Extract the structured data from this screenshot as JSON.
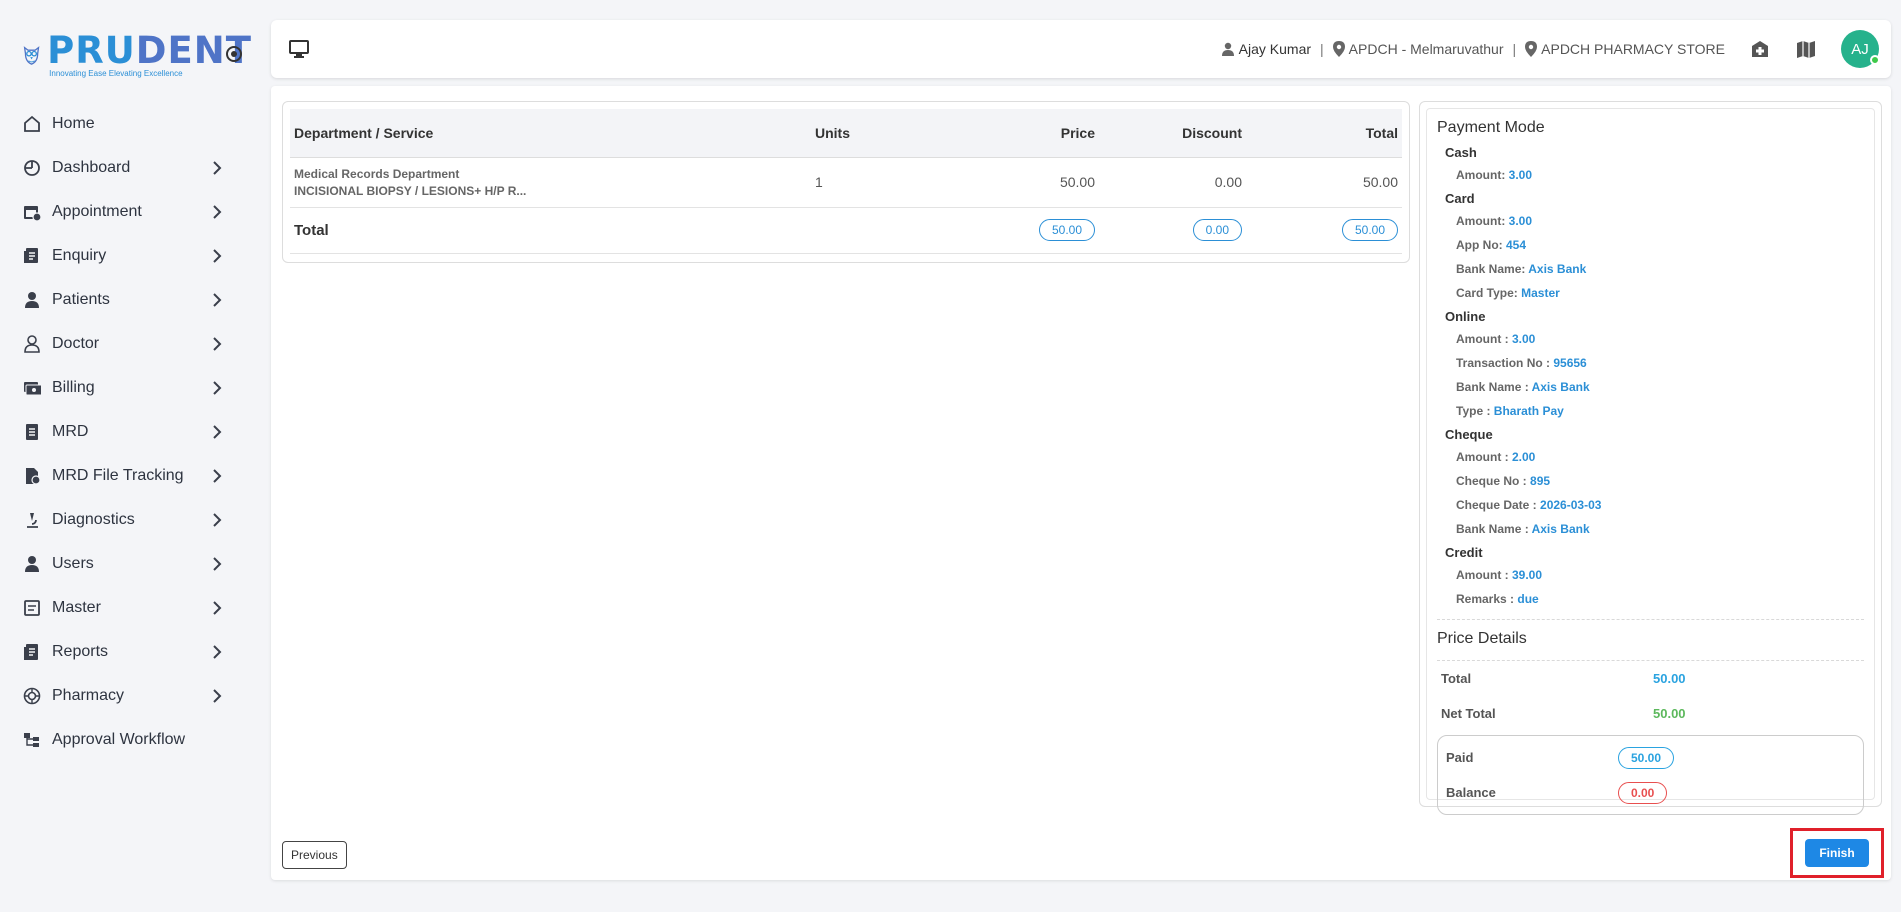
{
  "brand": {
    "name_part1": "PRU",
    "name_part2": "DENT",
    "tagline": "Innovating Ease Elevating Excellence"
  },
  "sidebar": {
    "items": [
      {
        "label": "Home",
        "icon": "home-icon",
        "has_chevron": false
      },
      {
        "label": "Dashboard",
        "icon": "dashboard-icon",
        "has_chevron": true
      },
      {
        "label": "Appointment",
        "icon": "calendar-icon",
        "has_chevron": true
      },
      {
        "label": "Enquiry",
        "icon": "enquiry-icon",
        "has_chevron": true
      },
      {
        "label": "Patients",
        "icon": "person-icon",
        "has_chevron": true
      },
      {
        "label": "Doctor",
        "icon": "doctor-icon",
        "has_chevron": true
      },
      {
        "label": "Billing",
        "icon": "billing-icon",
        "has_chevron": true
      },
      {
        "label": "MRD",
        "icon": "document-icon",
        "has_chevron": true
      },
      {
        "label": "MRD File Tracking",
        "icon": "file-tracking-icon",
        "has_chevron": true
      },
      {
        "label": "Diagnostics",
        "icon": "microscope-icon",
        "has_chevron": true
      },
      {
        "label": "Users",
        "icon": "user-icon",
        "has_chevron": true
      },
      {
        "label": "Master",
        "icon": "master-icon",
        "has_chevron": true
      },
      {
        "label": "Reports",
        "icon": "report-icon",
        "has_chevron": true
      },
      {
        "label": "Pharmacy",
        "icon": "pharmacy-icon",
        "has_chevron": true
      },
      {
        "label": "Approval Workflow",
        "icon": "workflow-icon",
        "has_chevron": false
      }
    ]
  },
  "topbar": {
    "user_name": "Ajay Kumar",
    "location": "APDCH - Melmaruvathur",
    "store": "APDCH PHARMACY STORE",
    "avatar_initials": "AJ",
    "sep": "|"
  },
  "services": {
    "headers": {
      "dept": "Department / Service",
      "units": "Units",
      "price": "Price",
      "discount": "Discount",
      "total": "Total"
    },
    "rows": [
      {
        "department": "Medical Records Department",
        "service": "INCISIONAL BIOPSY / LESIONS+ H/P R...",
        "units": "1",
        "price": "50.00",
        "discount": "0.00",
        "total": "50.00"
      }
    ],
    "totals": {
      "label": "Total",
      "price": "50.00",
      "discount": "0.00",
      "total": "50.00"
    }
  },
  "payment": {
    "title": "Payment Mode",
    "cash": {
      "label": "Cash",
      "amount_label": "Amount:",
      "amount": "3.00"
    },
    "card": {
      "label": "Card",
      "amount_label": "Amount:",
      "amount": "3.00",
      "app_label": "App No:",
      "app_no": "454",
      "bank_label": "Bank Name:",
      "bank": "Axis Bank",
      "type_label": "Card Type:",
      "type": "Master"
    },
    "online": {
      "label": "Online",
      "amount_label": "Amount :",
      "amount": "3.00",
      "txn_label": "Transaction No :",
      "txn": "95656",
      "bank_label": "Bank Name :",
      "bank": "Axis Bank",
      "type_label": "Type :",
      "type": "Bharath Pay"
    },
    "cheque": {
      "label": "Cheque",
      "amount_label": "Amount :",
      "amount": "2.00",
      "no_label": "Cheque No :",
      "no": "895",
      "date_label": "Cheque Date :",
      "date": "2026-03-03",
      "bank_label": "Bank Name :",
      "bank": "Axis Bank"
    },
    "credit": {
      "label": "Credit",
      "amount_label": "Amount :",
      "amount": "39.00",
      "remarks_label": "Remarks :",
      "remarks": "due"
    }
  },
  "price_details": {
    "title": "Price Details",
    "total_label": "Total",
    "total": "50.00",
    "net_label": "Net Total",
    "net": "50.00",
    "paid_label": "Paid",
    "paid": "50.00",
    "balance_label": "Balance",
    "balance": "0.00"
  },
  "buttons": {
    "previous": "Previous",
    "finish": "Finish"
  },
  "colors": {
    "accent": "#1e88e5",
    "link_blue": "#2b8fd6",
    "green": "#5cb85c",
    "red": "#e84f4f",
    "highlight_border": "#e0202a"
  }
}
